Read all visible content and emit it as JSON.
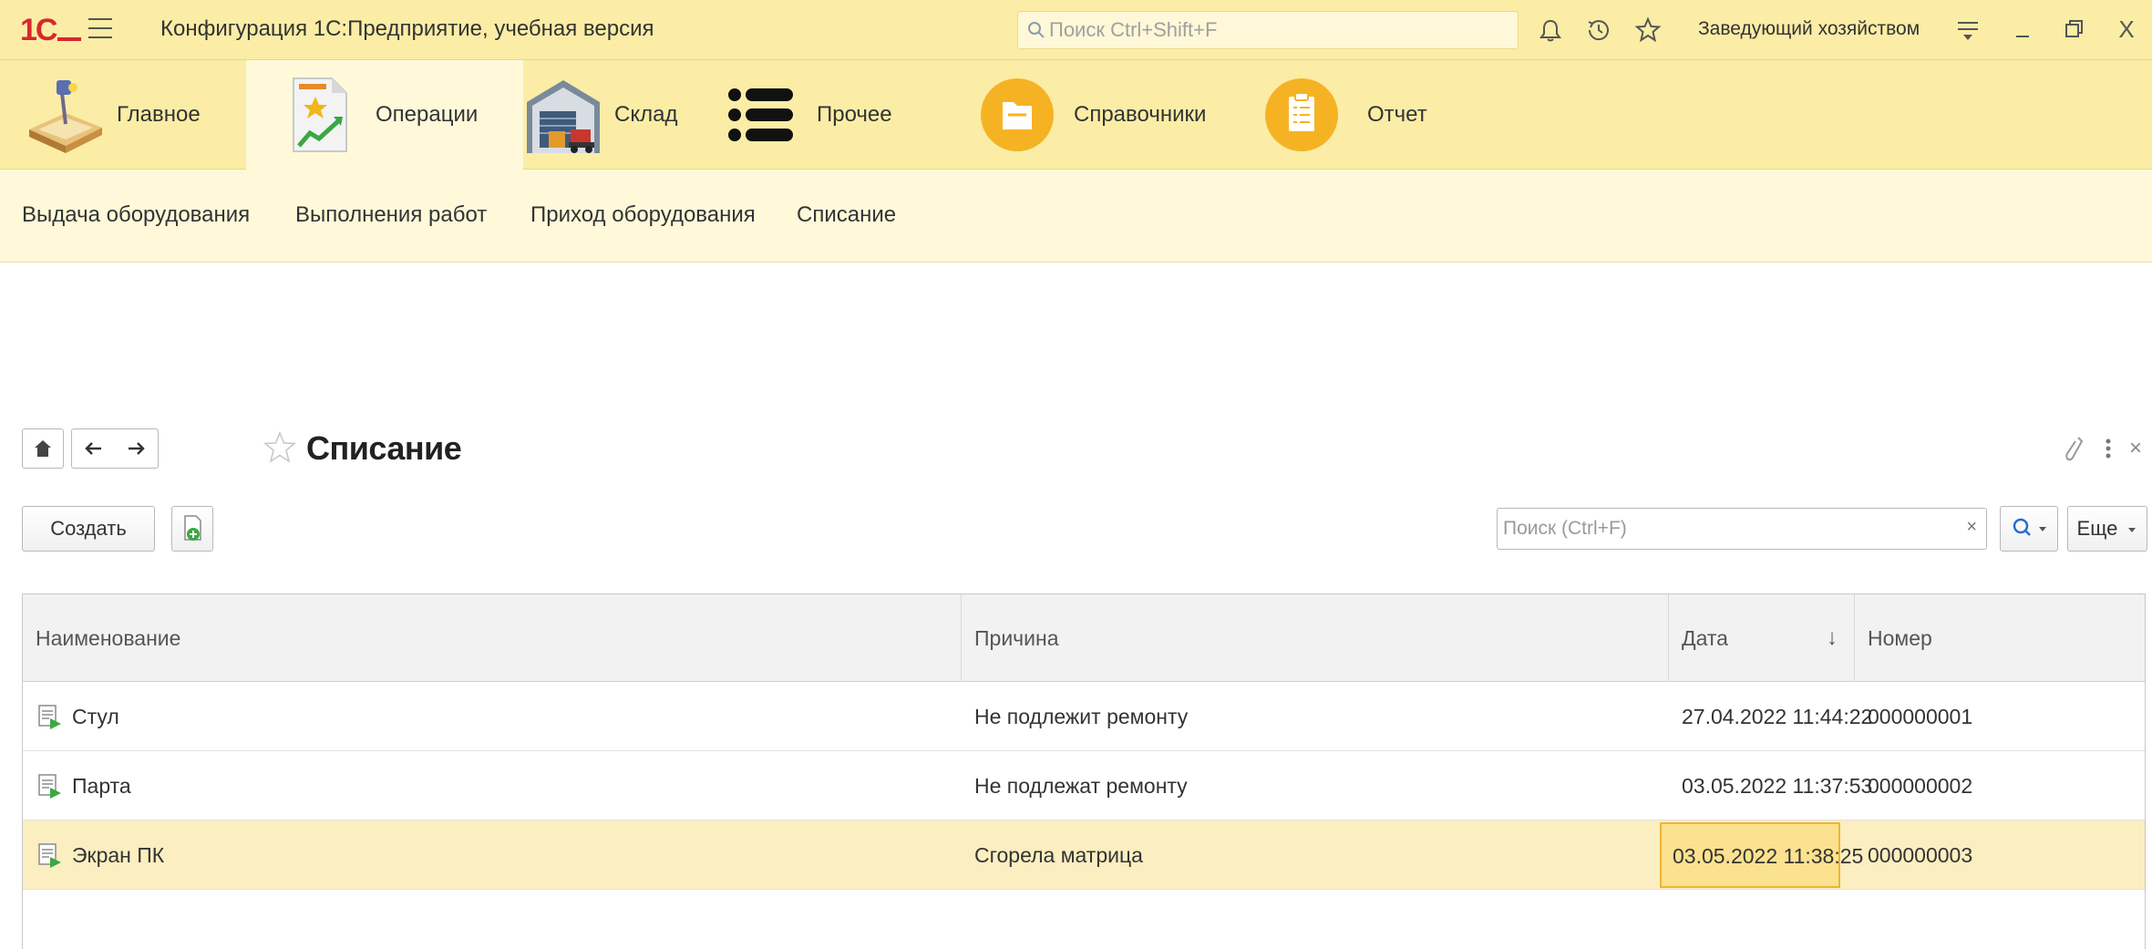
{
  "titlebar": {
    "logo": "1С",
    "app_title": "Конфигурация 1С:Предприятие, учебная версия",
    "search_placeholder": "Поиск Ctrl+Shift+F",
    "user_name": "Заведующий хозяйством",
    "icons": [
      "menu-icon",
      "bell-icon",
      "history-icon",
      "star-icon",
      "settings-icon",
      "minimize-icon",
      "restore-icon",
      "close-icon"
    ],
    "close_label": "X"
  },
  "sections": [
    {
      "label": "Главное",
      "icon": "desk-lamp-icon"
    },
    {
      "label": "Операции",
      "icon": "document-chart-icon",
      "active": true
    },
    {
      "label": "Склад",
      "icon": "warehouse-icon"
    },
    {
      "label": "Прочее",
      "icon": "list-icon"
    },
    {
      "label": "Справочники",
      "icon": "folder-circle-icon"
    },
    {
      "label": "Отчет",
      "icon": "clipboard-circle-icon"
    }
  ],
  "commands": [
    "Выдача оборудования",
    "Выполнения работ",
    "Приход оборудования",
    "Списание"
  ],
  "form": {
    "title": "Списание",
    "create_label": "Создать",
    "search_placeholder": "Поиск (Ctrl+F)",
    "clear_label": "×",
    "more_label": "Еще",
    "close_label": "×"
  },
  "table": {
    "columns": [
      "Наименование",
      "Причина",
      "Дата",
      "Номер"
    ],
    "sort_indicator": "↓",
    "rows": [
      {
        "name": "Стул",
        "reason": "Не подлежит ремонту",
        "date": "27.04.2022 11:44:22",
        "number": "000000001"
      },
      {
        "name": "Парта",
        "reason": "Не подлежат ремонту",
        "date": "03.05.2022 11:37:53",
        "number": "000000002"
      },
      {
        "name": "Экран ПК",
        "reason": "Сгорела матрица",
        "date": "03.05.2022 11:38:25",
        "number": "000000003",
        "selected": true
      }
    ]
  },
  "colors": {
    "panel_yellow": "#fbeda6",
    "light_yellow": "#fff9d9",
    "selection": "#fbeec0",
    "focus_cell": "#fbe28f",
    "orange_icon": "#f5b324",
    "logo_red": "#d7282f"
  }
}
